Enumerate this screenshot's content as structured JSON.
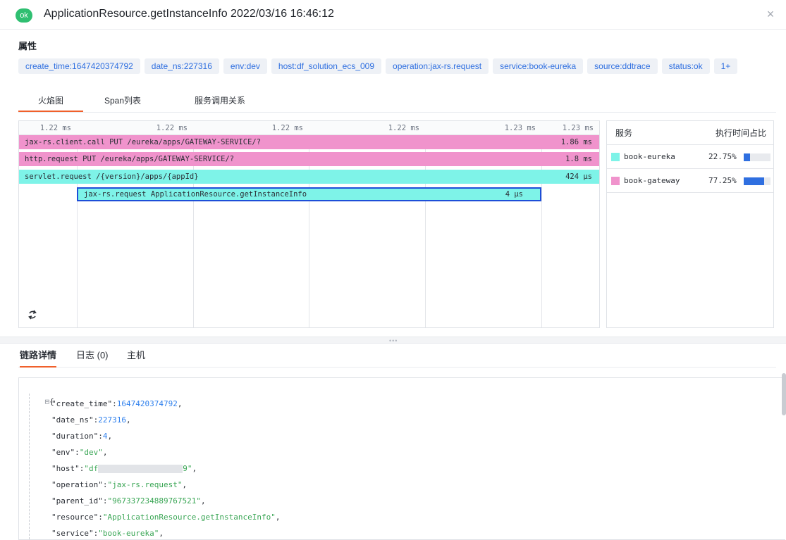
{
  "header": {
    "status_badge": "ok",
    "title": "ApplicationResource.getInstanceInfo   2022/03/16 16:46:12",
    "close_symbol": "×"
  },
  "attributes": {
    "heading": "属性",
    "tags": [
      "create_time:1647420374792",
      "date_ns:227316",
      "env:dev",
      "host:df_solution_ecs_009",
      "operation:jax-rs.request",
      "service:book-eureka",
      "source:ddtrace",
      "status:ok",
      "1+"
    ]
  },
  "tabs": [
    "火焰图",
    "Span列表",
    "服务调用关系"
  ],
  "flame": {
    "ticks": [
      "1.22 ms",
      "1.22 ms",
      "1.22 ms",
      "1.22 ms",
      "1.23 ms",
      "1.23 ms"
    ],
    "spans": [
      {
        "label": "jax-rs.client.call PUT /eureka/apps/GATEWAY-SERVICE/?",
        "duration": "1.86 ms",
        "service": "book-gateway"
      },
      {
        "label": "http.request PUT /eureka/apps/GATEWAY-SERVICE/?",
        "duration": "1.8 ms",
        "service": "book-gateway"
      },
      {
        "label": "servlet.request /{version}/apps/{appId}",
        "duration": "424 µs",
        "service": "book-eureka"
      },
      {
        "label": "jax-rs.request ApplicationResource.getInstanceInfo",
        "duration": "4 µs",
        "service": "book-eureka"
      }
    ],
    "refresh_icon": "refresh-icon"
  },
  "legend": {
    "col_service": "服务",
    "col_ratio": "执行时间占比",
    "rows": [
      {
        "name": "book-eureka",
        "percent": "22.75%",
        "value": 22.75,
        "color": "#7ef3e8"
      },
      {
        "name": "book-gateway",
        "percent": "77.25%",
        "value": 77.25,
        "color": "#f093cc"
      }
    ]
  },
  "colors": {
    "gateway": "#f093cc",
    "eureka": "#7ef3e8",
    "selected_border": "#1d4ed8",
    "accent_tab": "#f0602b",
    "link_blue": "#2f6fe0"
  },
  "bottom_tabs": [
    "链路详情",
    "日志 (0)",
    "主机"
  ],
  "json_view": {
    "open": "{",
    "toggle": "⊟",
    "lines": [
      {
        "key": "\"create_time\"",
        "value": "1647420374792",
        "type": "num"
      },
      {
        "key": "\"date_ns\"",
        "value": "227316",
        "type": "num"
      },
      {
        "key": "\"duration\"",
        "value": "4",
        "type": "num"
      },
      {
        "key": "\"env\"",
        "value": "\"dev\"",
        "type": "str"
      },
      {
        "key": "\"host\"",
        "value_prefix": "\"df",
        "value_suffix": "9\"",
        "type": "redacted"
      },
      {
        "key": "\"operation\"",
        "value": "\"jax-rs.request\"",
        "type": "str"
      },
      {
        "key": "\"parent_id\"",
        "value": "\"967337234889767521\"",
        "type": "str"
      },
      {
        "key": "\"resource\"",
        "value": "\"ApplicationResource.getInstanceInfo\"",
        "type": "str"
      },
      {
        "key": "\"service\"",
        "value": "\"book-eureka\"",
        "type": "str"
      }
    ]
  }
}
